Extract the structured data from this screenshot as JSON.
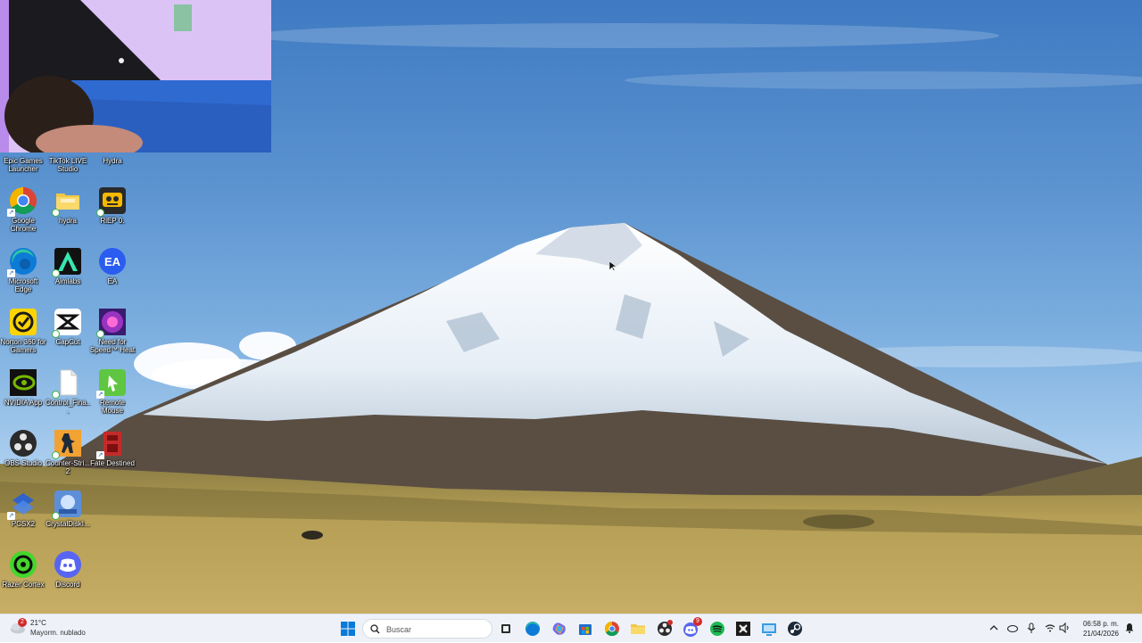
{
  "desktop": {
    "icons": [
      {
        "label": "Epic Games Launcher",
        "icon": "epic-games-icon"
      },
      {
        "label": "TikTok LIVE Studio",
        "icon": "tiktok-live-icon"
      },
      {
        "label": "Hydra",
        "icon": "hydra-icon"
      },
      {
        "label": "Google Chrome",
        "icon": "chrome-icon"
      },
      {
        "label": "hydra",
        "icon": "folder-icon"
      },
      {
        "label": "RiEP 0.",
        "icon": "riep-icon"
      },
      {
        "label": "Microsoft Edge",
        "icon": "edge-icon"
      },
      {
        "label": "Aimlabs",
        "icon": "aimlabs-icon"
      },
      {
        "label": "EA",
        "icon": "ea-icon"
      },
      {
        "label": "Norton 360 for Gamers",
        "icon": "norton-icon"
      },
      {
        "label": "CapCut",
        "icon": "capcut-icon"
      },
      {
        "label": "Need for Speed™ Heat",
        "icon": "nfs-heat-icon"
      },
      {
        "label": "NVIDIA App",
        "icon": "nvidia-icon"
      },
      {
        "label": "Control_Fina...",
        "icon": "file-icon"
      },
      {
        "label": "Remote Mouse",
        "icon": "remote-mouse-icon"
      },
      {
        "label": "OBS Studio",
        "icon": "obs-icon"
      },
      {
        "label": "Counter-Stri... 2",
        "icon": "counter-strike-icon"
      },
      {
        "label": "Fate Destined",
        "icon": "fate-destined-icon"
      },
      {
        "label": "PCSX2",
        "icon": "pcsx2-icon"
      },
      {
        "label": "CrystalDiskI...",
        "icon": "crystaldisk-icon"
      },
      {
        "label": "Razer Cortex",
        "icon": "razer-cortex-icon"
      },
      {
        "label": "Discord",
        "icon": "discord-icon"
      }
    ]
  },
  "taskbar": {
    "weather": {
      "temp": "21°C",
      "condition": "Mayorm. nublado",
      "badge": "2"
    },
    "search": {
      "placeholder": "Buscar"
    },
    "apps": [
      "windows-start-icon",
      "task-view-icon",
      "edge-icon",
      "copilot-icon",
      "store-icon",
      "chrome-icon",
      "file-explorer-icon",
      "obs-icon",
      "discord-icon",
      "spotify-icon",
      "game-icon",
      "screen-icon",
      "steam-icon"
    ],
    "tray": [
      "chevron-up-icon",
      "onedrive-icon",
      "microphone-icon",
      "wifi-icon",
      "speaker-icon"
    ],
    "clock": {
      "time": "06:58 p. m.",
      "date": "21/04/2026"
    },
    "discord_badge": "9"
  },
  "colors": {
    "taskbar_bg": "#eef2f8",
    "windows_blue": "#0a7ad8"
  }
}
